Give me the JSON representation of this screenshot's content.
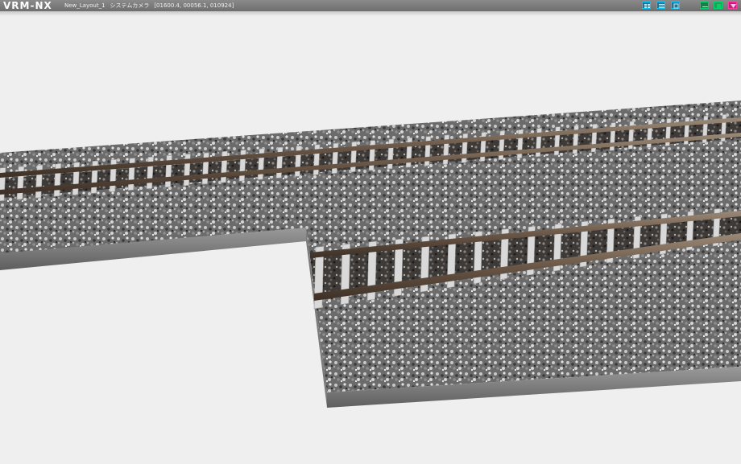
{
  "app": {
    "logo": "VRM-NX",
    "layout_name": "New_Layout_1",
    "camera_mode": "システムカメラ",
    "camera_coords": "[01600.4, 00056.1, 010924]"
  },
  "titlebar_buttons": [
    {
      "name": "view-grid",
      "icon": "grid-icon"
    },
    {
      "name": "view-list",
      "icon": "list-icon"
    },
    {
      "name": "view-window",
      "icon": "window-icon"
    },
    {
      "name": "minimize",
      "icon": "minimize-icon"
    },
    {
      "name": "maximize",
      "icon": "maximize-icon"
    },
    {
      "name": "close",
      "icon": "close-icon"
    }
  ],
  "colors": {
    "background": "#efefef",
    "titlebar": "#7a7a7a",
    "accent_cyan": "#00c8ff",
    "accent_green": "#00d46a",
    "accent_pink": "#ff3aa0",
    "ballast": "#6a6a6a",
    "rail": "#5a4a3a",
    "sleeper": "#d8d8d8",
    "concrete_edge": "#7e7e7e"
  }
}
